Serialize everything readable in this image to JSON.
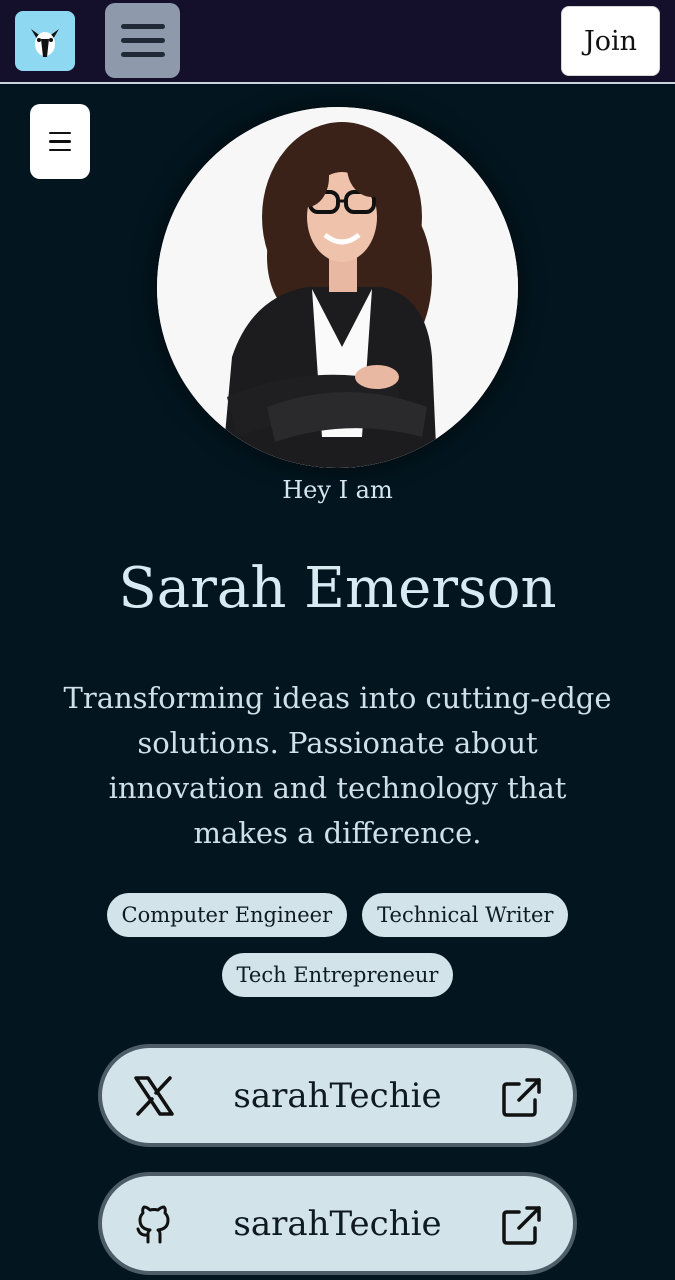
{
  "header": {
    "join_label": "Join"
  },
  "profile": {
    "greeting": "Hey I am",
    "name": "Sarah Emerson",
    "bio": "Transforming ideas into cutting-edge solutions. Passionate about innovation and technology that makes a difference.",
    "tags": [
      "Computer Engineer",
      "Technical Writer",
      "Tech Entrepreneur"
    ]
  },
  "links": [
    {
      "platform_icon": "x-icon",
      "label": "sarahTechie",
      "action_icon": "external-link-icon"
    },
    {
      "platform_icon": "github-icon",
      "label": "sarahTechie",
      "action_icon": "external-link-icon"
    }
  ],
  "colors": {
    "background": "#03151e",
    "header": "#140f2a",
    "logo_bg": "#8fd8f2",
    "chip_bg": "#d3e3ea",
    "text_light": "#d9ebf2"
  }
}
